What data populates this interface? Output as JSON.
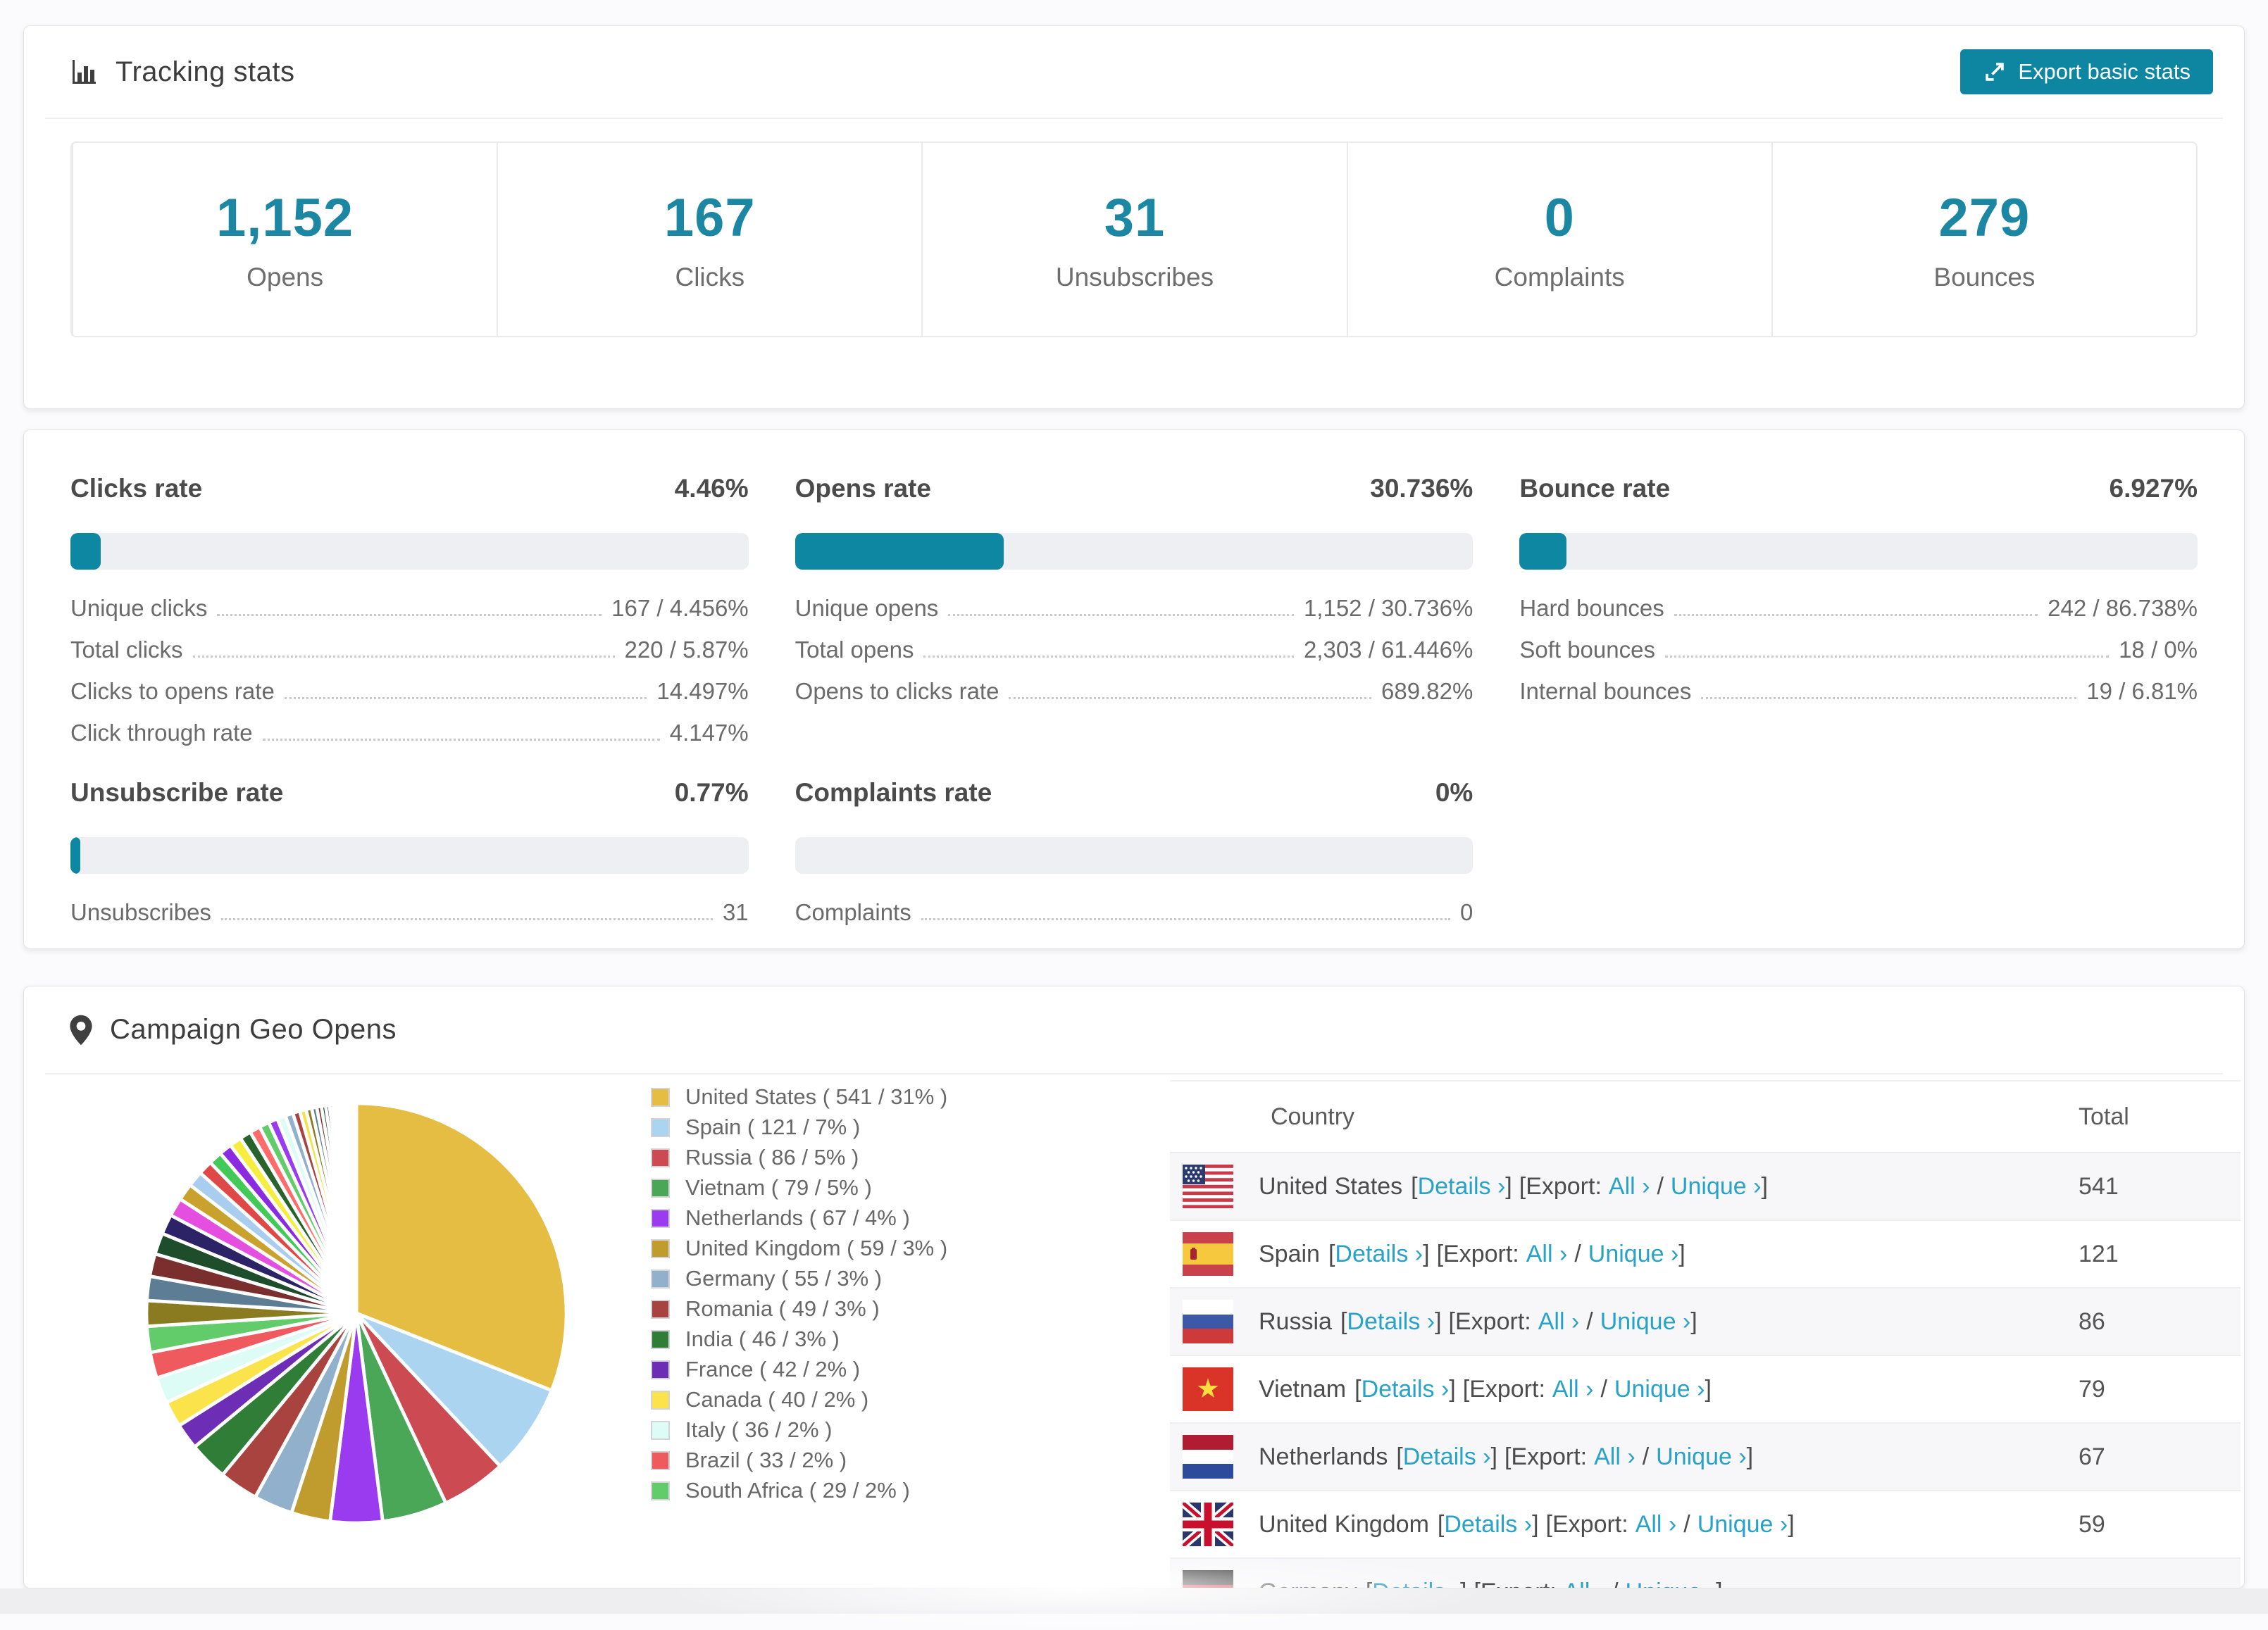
{
  "tracking": {
    "title": "Tracking stats",
    "export_label": "Export basic stats",
    "cards": [
      {
        "value": "1,152",
        "label": "Opens"
      },
      {
        "value": "167",
        "label": "Clicks"
      },
      {
        "value": "31",
        "label": "Unsubscribes"
      },
      {
        "value": "0",
        "label": "Complaints"
      },
      {
        "value": "279",
        "label": "Bounces"
      }
    ]
  },
  "rates": {
    "blocks": [
      {
        "title": "Clicks rate",
        "value": "4.46%",
        "pct": 4.46,
        "rows": [
          {
            "label": "Unique clicks",
            "value": "167 / 4.456%"
          },
          {
            "label": "Total clicks",
            "value": "220 / 5.87%"
          },
          {
            "label": "Clicks to opens rate",
            "value": "14.497%"
          },
          {
            "label": "Click through rate",
            "value": "4.147%"
          }
        ]
      },
      {
        "title": "Opens rate",
        "value": "30.736%",
        "pct": 30.736,
        "rows": [
          {
            "label": "Unique opens",
            "value": "1,152 / 30.736%"
          },
          {
            "label": "Total opens",
            "value": "2,303 / 61.446%"
          },
          {
            "label": "Opens to clicks rate",
            "value": "689.82%"
          }
        ]
      },
      {
        "title": "Bounce rate",
        "value": "6.927%",
        "pct": 6.927,
        "rows": [
          {
            "label": "Hard bounces",
            "value": "242 / 86.738%"
          },
          {
            "label": "Soft bounces",
            "value": "18 / 0%"
          },
          {
            "label": "Internal bounces",
            "value": "19 / 6.81%"
          }
        ]
      },
      {
        "title": "Unsubscribe rate",
        "value": "0.77%",
        "pct": 0.77,
        "rows": [
          {
            "label": "Unsubscribes",
            "value": "31"
          }
        ]
      },
      {
        "title": "Complaints rate",
        "value": "0%",
        "pct": 0,
        "rows": [
          {
            "label": "Complaints",
            "value": "0"
          }
        ]
      }
    ]
  },
  "geo": {
    "title": "Campaign Geo Opens",
    "legend": [
      {
        "label": "United States ( 541 / 31% )",
        "color": "#e6bd43"
      },
      {
        "label": "Spain ( 121 / 7% )",
        "color": "#abd4f1"
      },
      {
        "label": "Russia ( 86 / 5% )",
        "color": "#cc4a52"
      },
      {
        "label": "Vietnam ( 79 / 5% )",
        "color": "#4aa757"
      },
      {
        "label": "Netherlands ( 67 / 4% )",
        "color": "#9a3bf0"
      },
      {
        "label": "United Kingdom ( 59 / 3% )",
        "color": "#c09c2f"
      },
      {
        "label": "Germany ( 55 / 3% )",
        "color": "#90b0cc"
      },
      {
        "label": "Romania ( 49 / 3% )",
        "color": "#a84340"
      },
      {
        "label": "India ( 46 / 3% )",
        "color": "#2f7d36"
      },
      {
        "label": "France ( 42 / 2% )",
        "color": "#6d2db5"
      },
      {
        "label": "Canada ( 40 / 2% )",
        "color": "#fbe34b"
      },
      {
        "label": "Italy ( 36 / 2% )",
        "color": "#dcfcf5"
      },
      {
        "label": "Brazil ( 33 / 2% )",
        "color": "#ef5a5e"
      },
      {
        "label": "South Africa ( 29 / 2% )",
        "color": "#62cc6a"
      }
    ],
    "table": {
      "col_country": "Country",
      "col_total": "Total",
      "lb": "[",
      "rb": "]",
      "slash": "/",
      "details": "Details ›",
      "export": "Export:",
      "all": "All ›",
      "unique": "Unique ›",
      "rows": [
        {
          "country": "United States",
          "flag": "us",
          "total": "541"
        },
        {
          "country": "Spain",
          "flag": "es",
          "total": "121"
        },
        {
          "country": "Russia",
          "flag": "ru",
          "total": "86"
        },
        {
          "country": "Vietnam",
          "flag": "vn",
          "total": "79"
        },
        {
          "country": "Netherlands",
          "flag": "nl",
          "total": "67"
        },
        {
          "country": "United Kingdom",
          "flag": "gb",
          "total": "59"
        },
        {
          "country": "Germany",
          "flag": "de",
          "total": ""
        }
      ]
    }
  },
  "chart_data": {
    "type": "pie",
    "title": "Campaign Geo Opens",
    "unit": "opens",
    "start_angle_deg": -90,
    "direction": "clockwise",
    "legend_position": "right",
    "series": [
      {
        "name": "United States",
        "opens": 541,
        "pct": 31,
        "color": "#e6bd43"
      },
      {
        "name": "Spain",
        "opens": 121,
        "pct": 7,
        "color": "#abd4f1"
      },
      {
        "name": "Russia",
        "opens": 86,
        "pct": 5,
        "color": "#cc4a52"
      },
      {
        "name": "Vietnam",
        "opens": 79,
        "pct": 5,
        "color": "#4aa757"
      },
      {
        "name": "Netherlands",
        "opens": 67,
        "pct": 4,
        "color": "#9a3bf0"
      },
      {
        "name": "United Kingdom",
        "opens": 59,
        "pct": 3,
        "color": "#c09c2f"
      },
      {
        "name": "Germany",
        "opens": 55,
        "pct": 3,
        "color": "#90b0cc"
      },
      {
        "name": "Romania",
        "opens": 49,
        "pct": 3,
        "color": "#a84340"
      },
      {
        "name": "India",
        "opens": 46,
        "pct": 3,
        "color": "#2f7d36"
      },
      {
        "name": "France",
        "opens": 42,
        "pct": 2,
        "color": "#6d2db5"
      },
      {
        "name": "Canada",
        "opens": 40,
        "pct": 2,
        "color": "#fbe34b"
      },
      {
        "name": "Italy",
        "opens": 36,
        "pct": 2,
        "color": "#dcfcf5"
      },
      {
        "name": "Brazil",
        "opens": 33,
        "pct": 2,
        "color": "#ef5a5e"
      },
      {
        "name": "South Africa",
        "opens": 29,
        "pct": 2,
        "color": "#62cc6a"
      }
    ],
    "others_slices_pct": [
      1.8,
      1.7,
      1.6,
      1.5,
      1.4,
      1.3,
      1.2,
      1.1,
      1.0,
      0.95,
      0.9,
      0.85,
      0.8,
      0.75,
      0.7,
      0.65,
      0.6,
      0.55,
      0.5,
      0.45,
      0.4,
      0.36,
      0.33,
      0.3,
      0.27,
      0.24,
      0.21,
      0.19,
      0.17,
      0.15,
      0.13,
      0.11,
      0.1,
      0.09,
      0.08,
      0.07,
      0.06,
      0.05,
      0.05,
      0.04,
      0.04,
      0.03,
      0.03,
      0.02,
      0.02
    ],
    "others_palette": [
      "#8a7a20",
      "#5d7d95",
      "#7a2e2e",
      "#1e4d2b",
      "#2b2365",
      "#e44fe0",
      "#c9a22e",
      "#a8cdee",
      "#e04848",
      "#43c957",
      "#8a2be2",
      "#f5ee3e",
      "#27632a",
      "#ff6b6b",
      "#62cc6a",
      "#9a3bf0",
      "#dcfcf5",
      "#90b0cc",
      "#a84340",
      "#f2e34c"
    ]
  }
}
